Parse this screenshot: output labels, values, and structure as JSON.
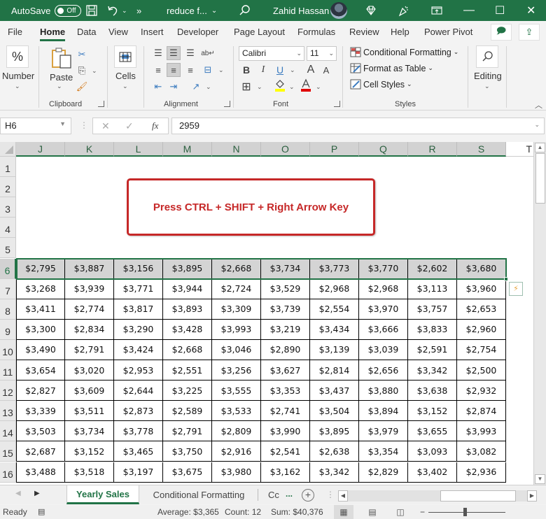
{
  "titlebar": {
    "autosave_label": "AutoSave",
    "autosave_state": "Off",
    "more_label": "»",
    "doc_title": "reduce f...",
    "user_name": "Zahid Hassan",
    "minimize": "—",
    "maximize": "☐",
    "close": "✕"
  },
  "menu": {
    "tabs": [
      "File",
      "Home",
      "Data",
      "View",
      "Insert",
      "Developer",
      "Page Layout",
      "Formulas",
      "Review",
      "Help",
      "Power Pivot"
    ],
    "active_tab": "Home"
  },
  "ribbon": {
    "number": {
      "icon": "%",
      "label": "Number"
    },
    "clipboard": {
      "paste_label": "Paste",
      "group_label": "Clipboard"
    },
    "cells": {
      "label": "Cells"
    },
    "alignment": {
      "group_label": "Alignment"
    },
    "font": {
      "font_name": "Calibri",
      "font_size": "11",
      "bold": "B",
      "italic": "I",
      "underline": "U",
      "grow": "A",
      "shrink": "A",
      "group_label": "Font",
      "fill_color": "#ffff00",
      "font_color": "#e00000"
    },
    "styles": {
      "conditional_formatting": "Conditional Formatting",
      "format_as_table": "Format as Table",
      "cell_styles": "Cell Styles",
      "group_label": "Styles"
    },
    "editing": {
      "label": "Editing"
    }
  },
  "formula_bar": {
    "name_box": "H6",
    "cancel": "✕",
    "enter": "✓",
    "fx": "fx",
    "value": "2959"
  },
  "sheet": {
    "columns": [
      "J",
      "K",
      "L",
      "M",
      "N",
      "O",
      "P",
      "Q",
      "R",
      "S"
    ],
    "extra_column": "T",
    "row_numbers": [
      "1",
      "2",
      "3",
      "4",
      "5",
      "6",
      "7",
      "8",
      "9",
      "10",
      "11",
      "12",
      "13",
      "14",
      "15",
      "16"
    ],
    "callout_text": "Press CTRL + SHIFT + Right Arrow Key",
    "selected_row": "6",
    "data_rows": [
      {
        "row": "6",
        "values": [
          "$2,795",
          "$3,887",
          "$3,156",
          "$3,895",
          "$2,668",
          "$3,734",
          "$3,773",
          "$3,770",
          "$2,602",
          "$3,680"
        ]
      },
      {
        "row": "7",
        "values": [
          "$3,268",
          "$3,939",
          "$3,771",
          "$3,944",
          "$2,724",
          "$3,529",
          "$2,968",
          "$2,968",
          "$3,113",
          "$3,960"
        ]
      },
      {
        "row": "8",
        "values": [
          "$3,411",
          "$2,774",
          "$3,817",
          "$3,893",
          "$3,309",
          "$3,739",
          "$2,554",
          "$3,970",
          "$3,757",
          "$2,653"
        ]
      },
      {
        "row": "9",
        "values": [
          "$3,300",
          "$2,834",
          "$3,290",
          "$3,428",
          "$3,993",
          "$3,219",
          "$3,434",
          "$3,666",
          "$3,833",
          "$2,960"
        ]
      },
      {
        "row": "10",
        "values": [
          "$3,490",
          "$2,791",
          "$3,424",
          "$2,668",
          "$3,046",
          "$2,890",
          "$3,139",
          "$3,039",
          "$2,591",
          "$2,754"
        ]
      },
      {
        "row": "11",
        "values": [
          "$3,654",
          "$3,020",
          "$2,953",
          "$2,551",
          "$3,256",
          "$3,627",
          "$2,814",
          "$2,656",
          "$3,342",
          "$2,500"
        ]
      },
      {
        "row": "12",
        "values": [
          "$2,827",
          "$3,609",
          "$2,644",
          "$3,225",
          "$3,555",
          "$3,353",
          "$3,437",
          "$3,880",
          "$3,638",
          "$2,932"
        ]
      },
      {
        "row": "13",
        "values": [
          "$3,339",
          "$3,511",
          "$2,873",
          "$2,589",
          "$3,533",
          "$2,741",
          "$3,504",
          "$3,894",
          "$3,152",
          "$2,874"
        ]
      },
      {
        "row": "14",
        "values": [
          "$3,503",
          "$3,734",
          "$3,778",
          "$2,791",
          "$2,809",
          "$3,990",
          "$3,895",
          "$3,979",
          "$3,655",
          "$3,993"
        ]
      },
      {
        "row": "15",
        "values": [
          "$2,687",
          "$3,152",
          "$3,465",
          "$3,750",
          "$2,916",
          "$2,541",
          "$2,638",
          "$3,354",
          "$3,093",
          "$3,082"
        ]
      },
      {
        "row": "16",
        "values": [
          "$3,488",
          "$3,518",
          "$3,197",
          "$3,675",
          "$3,980",
          "$3,162",
          "$3,342",
          "$2,829",
          "$3,402",
          "$2,936"
        ]
      }
    ]
  },
  "sheet_tabs": {
    "tabs": [
      "Yearly Sales",
      "Conditional Formatting",
      "Cc"
    ],
    "active": "Yearly Sales",
    "more": "...",
    "add": "+"
  },
  "status_bar": {
    "mode": "Ready",
    "average": "Average: $3,365",
    "count": "Count: 12",
    "sum": "Sum: $40,376"
  }
}
